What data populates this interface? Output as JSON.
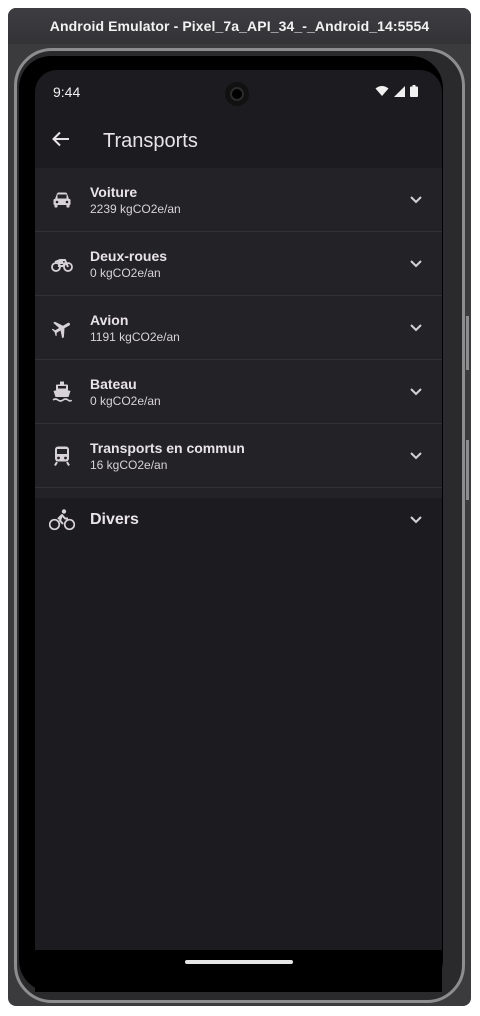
{
  "window": {
    "title": "Android Emulator - Pixel_7a_API_34_-_Android_14:5554"
  },
  "status_bar": {
    "time": "9:44"
  },
  "app_bar": {
    "title": "Transports"
  },
  "items": [
    {
      "icon": "car-icon",
      "title": "Voiture",
      "subtitle": "2239 kgCO2e/an"
    },
    {
      "icon": "motorcycle-icon",
      "title": "Deux-roues",
      "subtitle": "0 kgCO2e/an"
    },
    {
      "icon": "airplane-icon",
      "title": "Avion",
      "subtitle": "1191 kgCO2e/an"
    },
    {
      "icon": "boat-icon",
      "title": "Bateau",
      "subtitle": "0 kgCO2e/an"
    },
    {
      "icon": "train-icon",
      "title": "Transports en commun",
      "subtitle": "16 kgCO2e/an"
    },
    {
      "icon": "bicycle-icon",
      "title": "Divers"
    }
  ],
  "colors": {
    "background": "#1c1b1f",
    "list_background": "#232227",
    "text": "#e8e3e8"
  }
}
